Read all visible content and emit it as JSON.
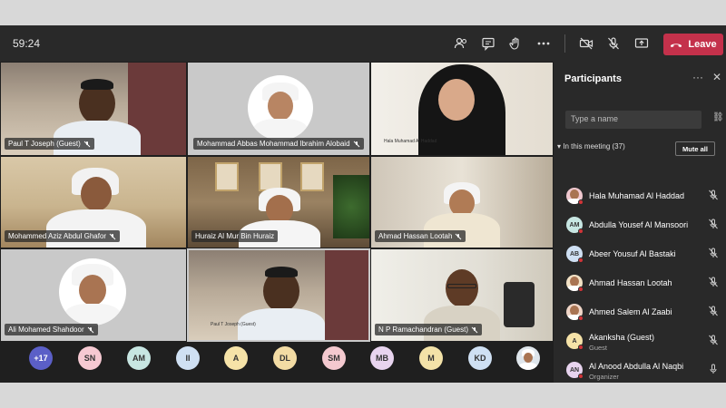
{
  "timer": "59:24",
  "leave_label": "Leave",
  "tiles": [
    {
      "name": "Paul T Joseph (Guest)"
    },
    {
      "name": "Mohammad Abbas Mohammad Ibrahim Alobaid"
    },
    {
      "name": "Hala Muhamad Al Haddad",
      "small": true
    },
    {
      "name": "Mohammed Aziz Abdul Ghafor"
    },
    {
      "name": "Huraiz Al Mur Bin Huraiz"
    },
    {
      "name": "Ahmad Hassan Lootah"
    },
    {
      "name": "Ali Mohamed Shahdoor"
    },
    {
      "name": "Paul T Joseph (Guest)",
      "small": true
    },
    {
      "name": "N P Ramachandran (Guest)"
    }
  ],
  "panel": {
    "title": "Participants",
    "invite_placeholder": "Type a name",
    "section_label": "In this meeting (37)",
    "mute_all_label": "Mute all",
    "participants": [
      {
        "initials": "",
        "name": "Hala Muhamad Al Haddad",
        "sub": "",
        "photo": true
      },
      {
        "initials": "AM",
        "name": "Abdulla Yousef Al Mansoori",
        "sub": ""
      },
      {
        "initials": "AB",
        "name": "Abeer Yousuf Al Bastaki",
        "sub": ""
      },
      {
        "initials": "",
        "name": "Ahmad Hassan Lootah",
        "sub": "",
        "photo": true
      },
      {
        "initials": "",
        "name": "Ahmed Salem Al Zaabi",
        "sub": "",
        "photo": true
      },
      {
        "initials": "A",
        "name": "Akanksha (Guest)",
        "sub": "Guest"
      },
      {
        "initials": "AN",
        "name": "Al Anood Abdulla Al Naqbi",
        "sub": "Organizer"
      },
      {
        "initials": "",
        "name": "Ali Mohamed Shahdoor",
        "sub": "",
        "photo": true
      }
    ]
  },
  "bottom_avatars": [
    {
      "label": "+17",
      "color": "#5b5fc7"
    },
    {
      "label": "SN",
      "color": "#f6c9d2"
    },
    {
      "label": "AM",
      "color": "#c7e6e2"
    },
    {
      "label": "II",
      "color": "#cfe0f3"
    },
    {
      "label": "A",
      "color": "#f6e3a8"
    },
    {
      "label": "DL",
      "color": "#f3dca4"
    },
    {
      "label": "SM",
      "color": "#f4c9cf"
    },
    {
      "label": "MB",
      "color": "#e8d4ef"
    },
    {
      "label": "M",
      "color": "#f3e2a8"
    },
    {
      "label": "KD",
      "color": "#cfe0f3"
    },
    {
      "label": "",
      "color": "#dfe6ec"
    }
  ],
  "colors": {
    "leave": "#c4314b",
    "accent": "#5b5fc7",
    "status_red": "#d13438"
  }
}
